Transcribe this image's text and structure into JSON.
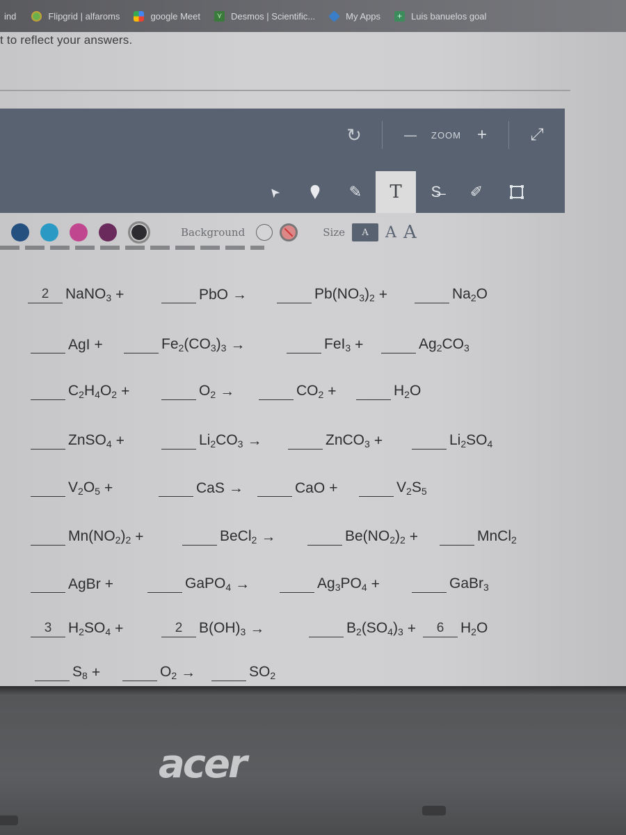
{
  "bookmarks": [
    {
      "label": "ind",
      "icon": "truncated"
    },
    {
      "label": "Flipgrid | alfaroms",
      "icon": "flipgrid-icon"
    },
    {
      "label": "google Meet",
      "icon": "meet-icon"
    },
    {
      "label": "Desmos | Scientific...",
      "icon": "desmos-icon"
    },
    {
      "label": "My Apps",
      "icon": "apps-icon"
    },
    {
      "label": "Luis banuelos goal",
      "icon": "sheet-icon"
    }
  ],
  "instruction": "t to reflect your answers.",
  "toolbar": {
    "reset_icon": "↻",
    "zoom_minus": "—",
    "zoom_label": "ZOOM",
    "zoom_plus": "+",
    "expand_icon": "⤢",
    "tools": [
      {
        "name": "select",
        "glyph": "➤"
      },
      {
        "name": "marker",
        "glyph": "●"
      },
      {
        "name": "pen",
        "glyph": "✎"
      },
      {
        "name": "text",
        "glyph": "T",
        "active": true
      },
      {
        "name": "strikethrough",
        "glyph": "S̶"
      },
      {
        "name": "highlighter",
        "glyph": "✐"
      },
      {
        "name": "shape",
        "glyph": "◻"
      }
    ]
  },
  "palette": {
    "colors": [
      "#23507f",
      "#2a9ac4",
      "#c0468f",
      "#6b2a5c",
      "#2d2d31"
    ],
    "selected_index": 4,
    "background_label": "Background",
    "size_label": "Size",
    "size_options": [
      "A",
      "A",
      "A"
    ],
    "selected_size_index": 0
  },
  "equations": [
    {
      "row": 0,
      "terms": [
        {
          "coef": "2",
          "formula": [
            "NaNO",
            [
              "3"
            ]
          ],
          "op": "+"
        },
        {
          "coef": "",
          "formula": [
            "PbO"
          ],
          "op": "→"
        },
        {
          "coef": "",
          "formula": [
            "Pb(NO",
            [
              "3"
            ],
            ")",
            [
              "2"
            ]
          ],
          "op": "+"
        },
        {
          "coef": "",
          "formula": [
            "Na",
            [
              "2"
            ],
            "O"
          ],
          "op": ""
        }
      ]
    },
    {
      "row": 1,
      "terms": [
        {
          "coef": "",
          "formula": [
            "AgI"
          ],
          "op": "+"
        },
        {
          "coef": "",
          "formula": [
            "Fe",
            [
              "2"
            ],
            "(CO",
            [
              "3"
            ],
            ")",
            [
              "3"
            ]
          ],
          "op": "→"
        },
        {
          "coef": "",
          "formula": [
            "FeI",
            [
              "3"
            ]
          ],
          "op": "+"
        },
        {
          "coef": "",
          "formula": [
            "Ag",
            [
              "2"
            ],
            "CO",
            [
              "3"
            ]
          ],
          "op": ""
        }
      ]
    },
    {
      "row": 2,
      "terms": [
        {
          "coef": "",
          "formula": [
            "C",
            [
              "2"
            ],
            "H",
            [
              "4"
            ],
            "O",
            [
              "2"
            ]
          ],
          "op": "+"
        },
        {
          "coef": "",
          "formula": [
            "O",
            [
              "2"
            ]
          ],
          "op": "→"
        },
        {
          "coef": "",
          "formula": [
            "CO",
            [
              "2"
            ]
          ],
          "op": "+"
        },
        {
          "coef": "",
          "formula": [
            "H",
            [
              "2"
            ],
            "O"
          ],
          "op": ""
        }
      ]
    },
    {
      "row": 3,
      "terms": [
        {
          "coef": "",
          "formula": [
            "ZnSO",
            [
              "4"
            ]
          ],
          "op": "+"
        },
        {
          "coef": "",
          "formula": [
            "Li",
            [
              "2"
            ],
            "CO",
            [
              "3"
            ]
          ],
          "op": "→"
        },
        {
          "coef": "",
          "formula": [
            "ZnCO",
            [
              "3"
            ]
          ],
          "op": "+"
        },
        {
          "coef": "",
          "formula": [
            "Li",
            [
              "2"
            ],
            "SO",
            [
              "4"
            ]
          ],
          "op": ""
        }
      ]
    },
    {
      "row": 4,
      "terms": [
        {
          "coef": "",
          "formula": [
            "V",
            [
              "2"
            ],
            "O",
            [
              "5"
            ]
          ],
          "op": "+"
        },
        {
          "coef": "",
          "formula": [
            "CaS"
          ],
          "op": "→"
        },
        {
          "coef": "",
          "formula": [
            "CaO"
          ],
          "op": "+"
        },
        {
          "coef": "",
          "formula": [
            "V",
            [
              "2"
            ],
            "S",
            [
              "5"
            ]
          ],
          "op": ""
        }
      ]
    },
    {
      "row": 5,
      "terms": [
        {
          "coef": "",
          "formula": [
            "Mn(NO",
            [
              "2"
            ],
            ")",
            [
              "2"
            ]
          ],
          "op": "+"
        },
        {
          "coef": "",
          "formula": [
            "BeCl",
            [
              "2"
            ]
          ],
          "op": "→"
        },
        {
          "coef": "",
          "formula": [
            "Be(NO",
            [
              "2"
            ],
            ")",
            [
              "2"
            ]
          ],
          "op": "+"
        },
        {
          "coef": "",
          "formula": [
            "MnCl",
            [
              "2"
            ]
          ],
          "op": ""
        }
      ]
    },
    {
      "row": 6,
      "terms": [
        {
          "coef": "",
          "formula": [
            "AgBr"
          ],
          "op": "+"
        },
        {
          "coef": "",
          "formula": [
            "GaPO",
            [
              "4"
            ]
          ],
          "op": "→"
        },
        {
          "coef": "",
          "formula": [
            "Ag",
            [
              "3"
            ],
            "PO",
            [
              "4"
            ]
          ],
          "op": "+"
        },
        {
          "coef": "",
          "formula": [
            "GaBr",
            [
              "3"
            ]
          ],
          "op": ""
        }
      ]
    },
    {
      "row": 7,
      "terms": [
        {
          "coef": "3",
          "formula": [
            "H",
            [
              "2"
            ],
            "SO",
            [
              "4"
            ]
          ],
          "op": "+"
        },
        {
          "coef": "2",
          "formula": [
            "B(OH)",
            [
              "3"
            ]
          ],
          "op": "→"
        },
        {
          "coef": "",
          "formula": [
            "B",
            [
              "2"
            ],
            "(SO",
            [
              "4"
            ],
            ")",
            [
              "3"
            ]
          ],
          "op": "+"
        },
        {
          "coef": "6",
          "formula": [
            "H",
            [
              "2"
            ],
            "O"
          ],
          "op": ""
        }
      ]
    },
    {
      "row": 8,
      "terms": [
        {
          "coef": "",
          "formula": [
            "S",
            [
              "8"
            ]
          ],
          "op": "+"
        },
        {
          "coef": "",
          "formula": [
            "O",
            [
              "2"
            ]
          ],
          "op": "→"
        },
        {
          "coef": "",
          "formula": [
            "SO",
            [
              "2"
            ]
          ],
          "op": ""
        }
      ]
    }
  ],
  "bezel": {
    "brand": "acer"
  }
}
